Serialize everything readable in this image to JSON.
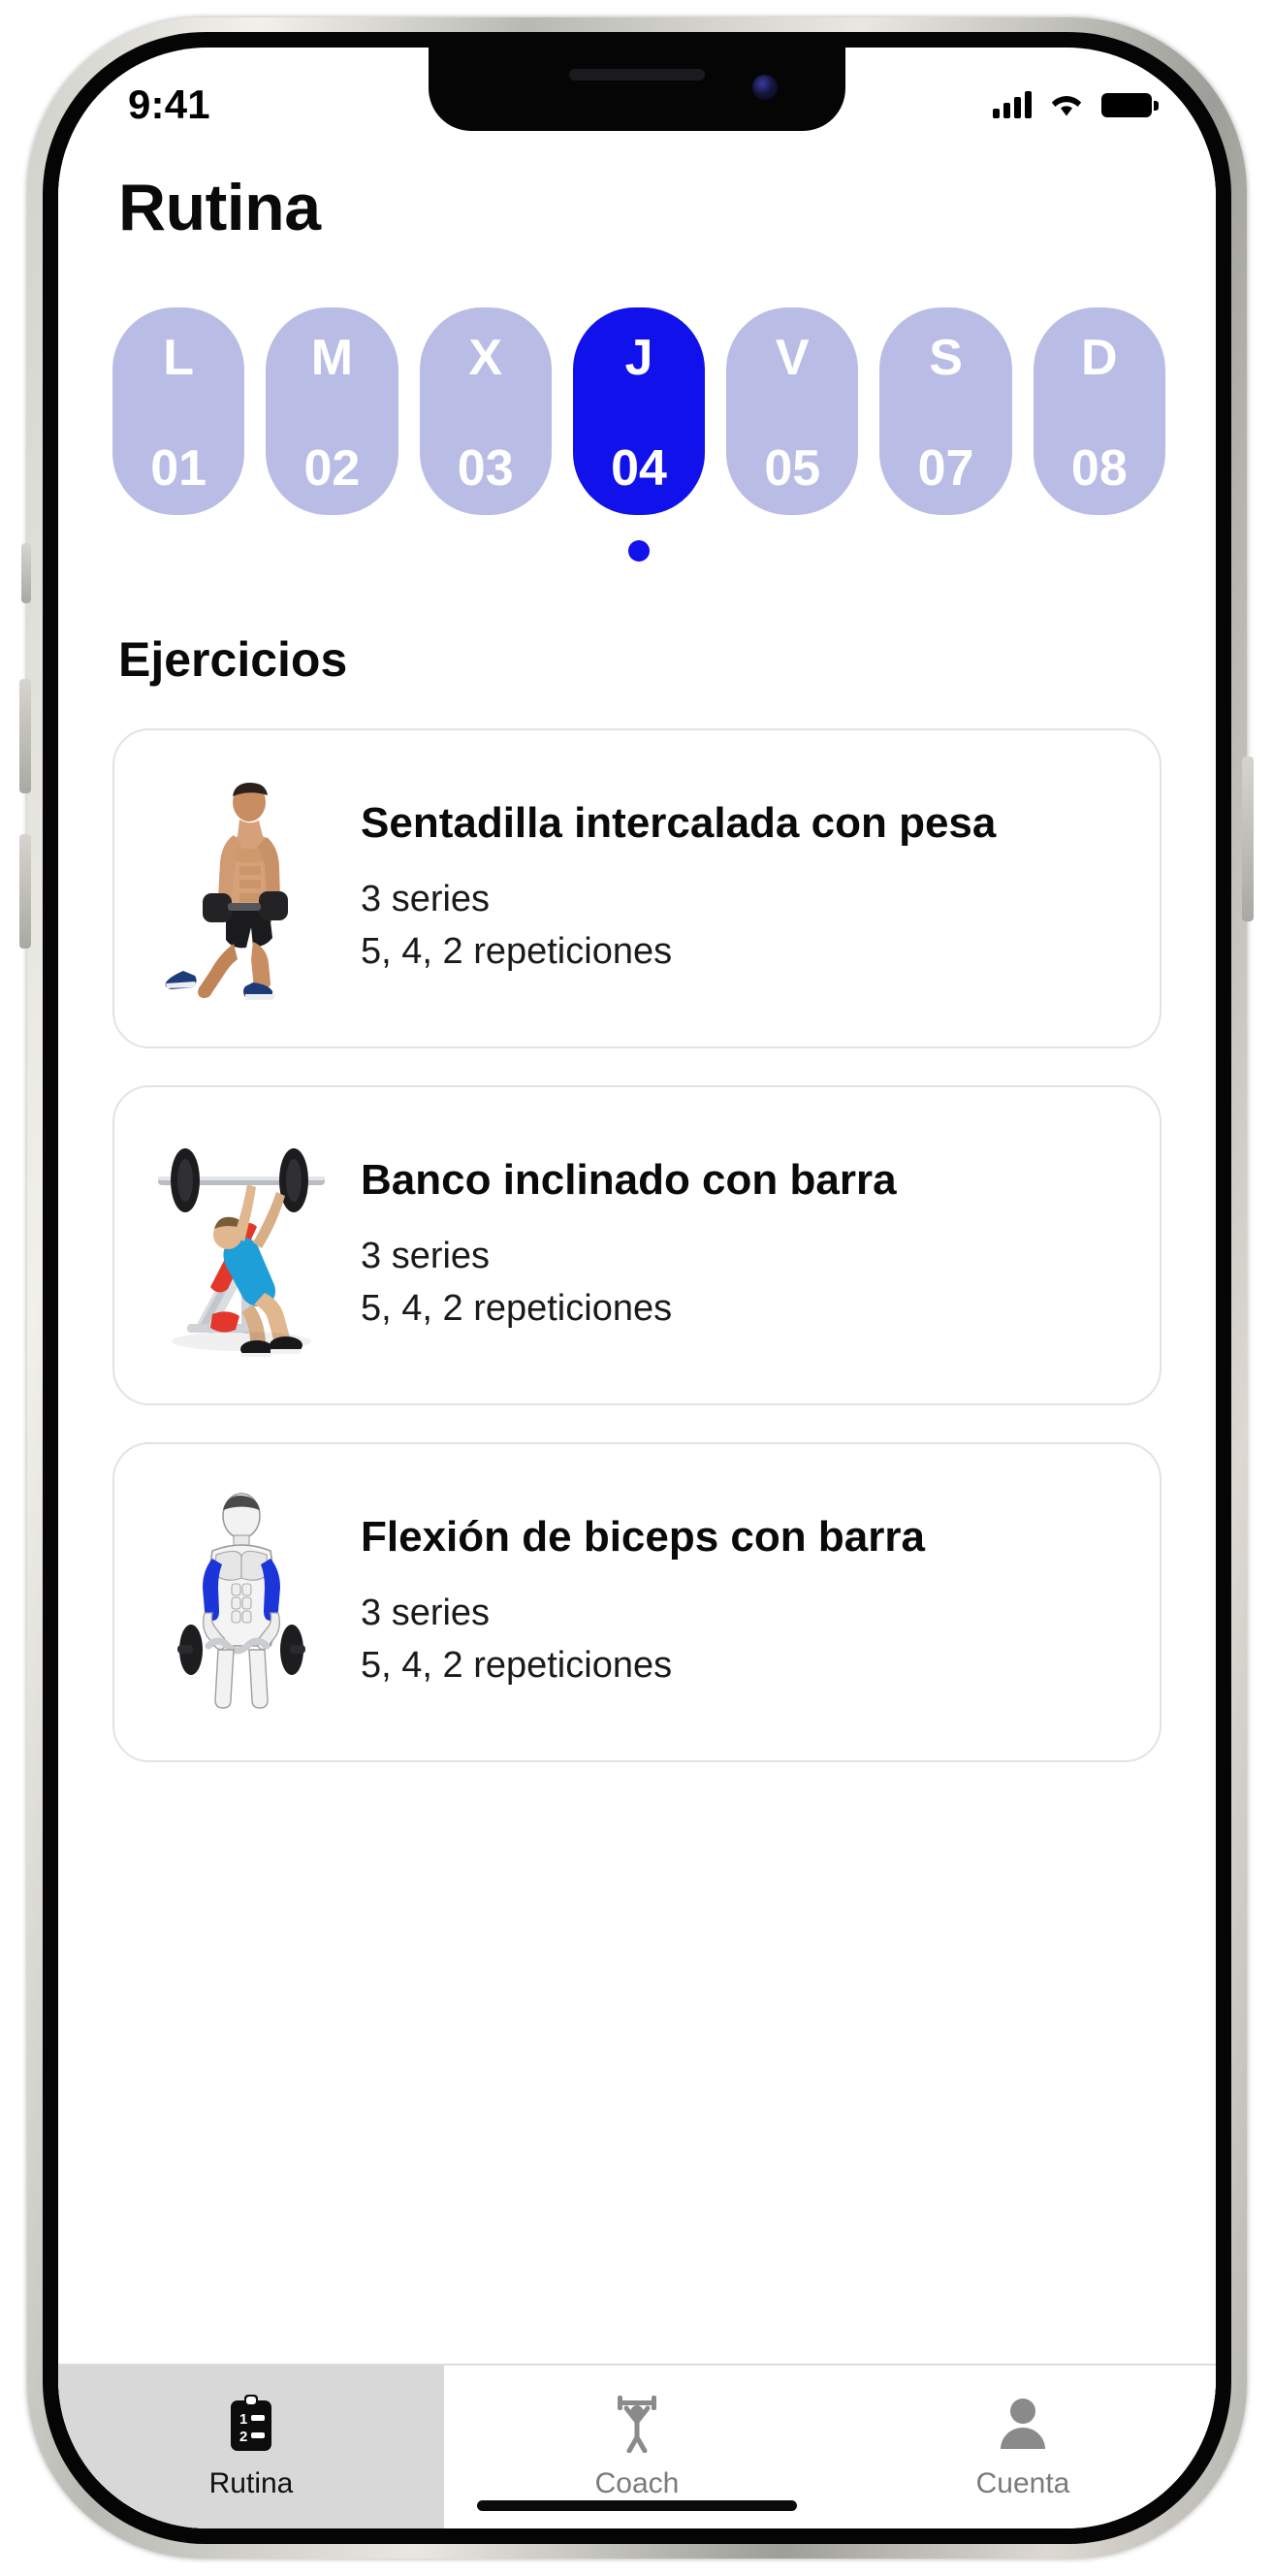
{
  "status_bar": {
    "time": "9:41",
    "icons": [
      "cellular-signal-icon",
      "wifi-icon",
      "battery-icon"
    ]
  },
  "header": {
    "title": "Rutina"
  },
  "day_selector": {
    "days": [
      {
        "letter": "L",
        "number": "01",
        "selected": false
      },
      {
        "letter": "M",
        "number": "02",
        "selected": false
      },
      {
        "letter": "X",
        "number": "03",
        "selected": false
      },
      {
        "letter": "J",
        "number": "04",
        "selected": true
      },
      {
        "letter": "V",
        "number": "05",
        "selected": false
      },
      {
        "letter": "S",
        "number": "07",
        "selected": false
      },
      {
        "letter": "D",
        "number": "08",
        "selected": false
      }
    ],
    "selected_index": 3,
    "selected_color": "#1111ec",
    "unselected_color": "#b9bde5",
    "label_color": "#ffffff"
  },
  "sections": {
    "exercises_title": "Ejercicios"
  },
  "exercises": [
    {
      "name": "Sentadilla intercalada con pesa",
      "sets": "3 series",
      "reps": "5, 4, 2 repeticiones",
      "image": "man-lunge-dumbbells-photo"
    },
    {
      "name": "Banco inclinado con barra",
      "sets": "3 series",
      "reps": "5, 4, 2 repeticiones",
      "image": "incline-bench-press-illustration"
    },
    {
      "name": "Flexión de biceps con barra",
      "sets": "3 series",
      "reps": "5, 4, 2 repeticiones",
      "image": "barbell-biceps-curl-anatomy-illustration"
    }
  ],
  "tab_bar": {
    "tabs": [
      {
        "label": "Rutina",
        "icon": "clipboard-list-icon",
        "active": true
      },
      {
        "label": "Coach",
        "icon": "weightlifter-icon",
        "active": false
      },
      {
        "label": "Cuenta",
        "icon": "person-icon",
        "active": false
      }
    ],
    "active_index": 0,
    "active_bg": "#d8d8d8",
    "inactive_color": "#7a7a7a"
  }
}
